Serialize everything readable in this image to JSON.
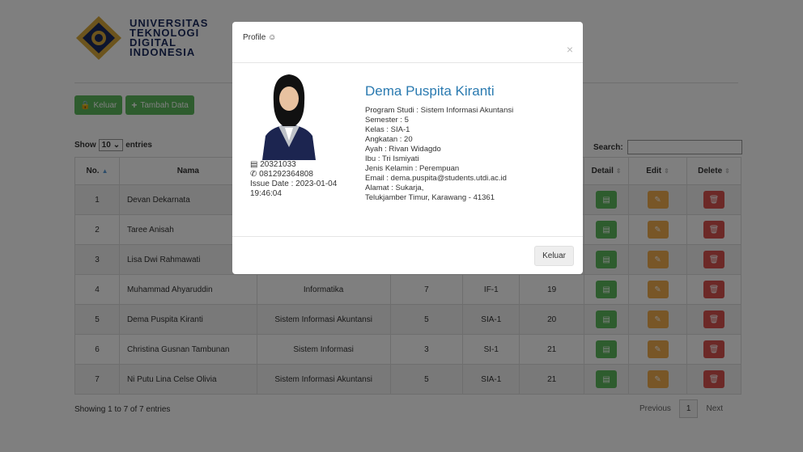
{
  "header": {
    "logo_lines": [
      "UNIVERSITAS",
      "TEKNOLOGI",
      "DIGITAL",
      "INDONESIA"
    ],
    "btn_keluar": "Keluar",
    "btn_tambah": "Tambah Data"
  },
  "controls": {
    "show_label": "Show",
    "entries_value": "10",
    "entries_label": "entries",
    "search_label": "Search:"
  },
  "table": {
    "headers": [
      "No.",
      "Nama",
      "Detail",
      "Edit",
      "Delete"
    ],
    "rows": [
      {
        "no": "1",
        "nama": "Devan Dekarnata",
        "prodi": "",
        "semester": "",
        "kelas": "",
        "angkatan": ""
      },
      {
        "no": "2",
        "nama": "Taree Anisah",
        "prodi": "",
        "semester": "",
        "kelas": "",
        "angkatan": ""
      },
      {
        "no": "3",
        "nama": "Lisa Dwi Rahmawati",
        "prodi": "",
        "semester": "",
        "kelas": "",
        "angkatan": ""
      },
      {
        "no": "4",
        "nama": "Muhammad Ahyaruddin",
        "prodi": "Informatika",
        "semester": "7",
        "kelas": "IF-1",
        "angkatan": "19"
      },
      {
        "no": "5",
        "nama": "Dema Puspita Kiranti",
        "prodi": "Sistem Informasi Akuntansi",
        "semester": "5",
        "kelas": "SIA-1",
        "angkatan": "20"
      },
      {
        "no": "6",
        "nama": "Christina Gusnan Tambunan",
        "prodi": "Sistem Informasi",
        "semester": "3",
        "kelas": "SI-1",
        "angkatan": "21"
      },
      {
        "no": "7",
        "nama": "Ni Putu Lina Celse Olivia",
        "prodi": "Sistem Informasi Akuntansi",
        "semester": "5",
        "kelas": "SIA-1",
        "angkatan": "21"
      }
    ]
  },
  "footer": {
    "info": "Showing 1 to 7 of 7 entries",
    "prev": "Previous",
    "page": "1",
    "next": "Next"
  },
  "modal": {
    "title": "Profile",
    "close": "×",
    "id": "20321033",
    "phone": "081292364808",
    "issue_date": "Issue Date : 2023-01-04",
    "issue_time": "19:46:04",
    "name": "Dema Puspita Kiranti",
    "details": [
      "Program Studi : Sistem Informasi Akuntansi",
      "Semester : 5",
      "Kelas : SIA-1",
      "Angkatan : 20",
      "Ayah : Rivan Widagdo",
      "Ibu : Tri Ismiyati",
      "Jenis Kelamin : Perempuan",
      "Email : dema.puspita@students.utdi.ac.id",
      "Alamat : Sukarja,",
      "Telukjamber Timur, Karawang - 41361"
    ],
    "button": "Keluar"
  },
  "colors": {
    "green": "#5cb85c",
    "orange": "#f0ad4e",
    "red": "#d9534f",
    "name_blue": "#2a7ab0"
  }
}
